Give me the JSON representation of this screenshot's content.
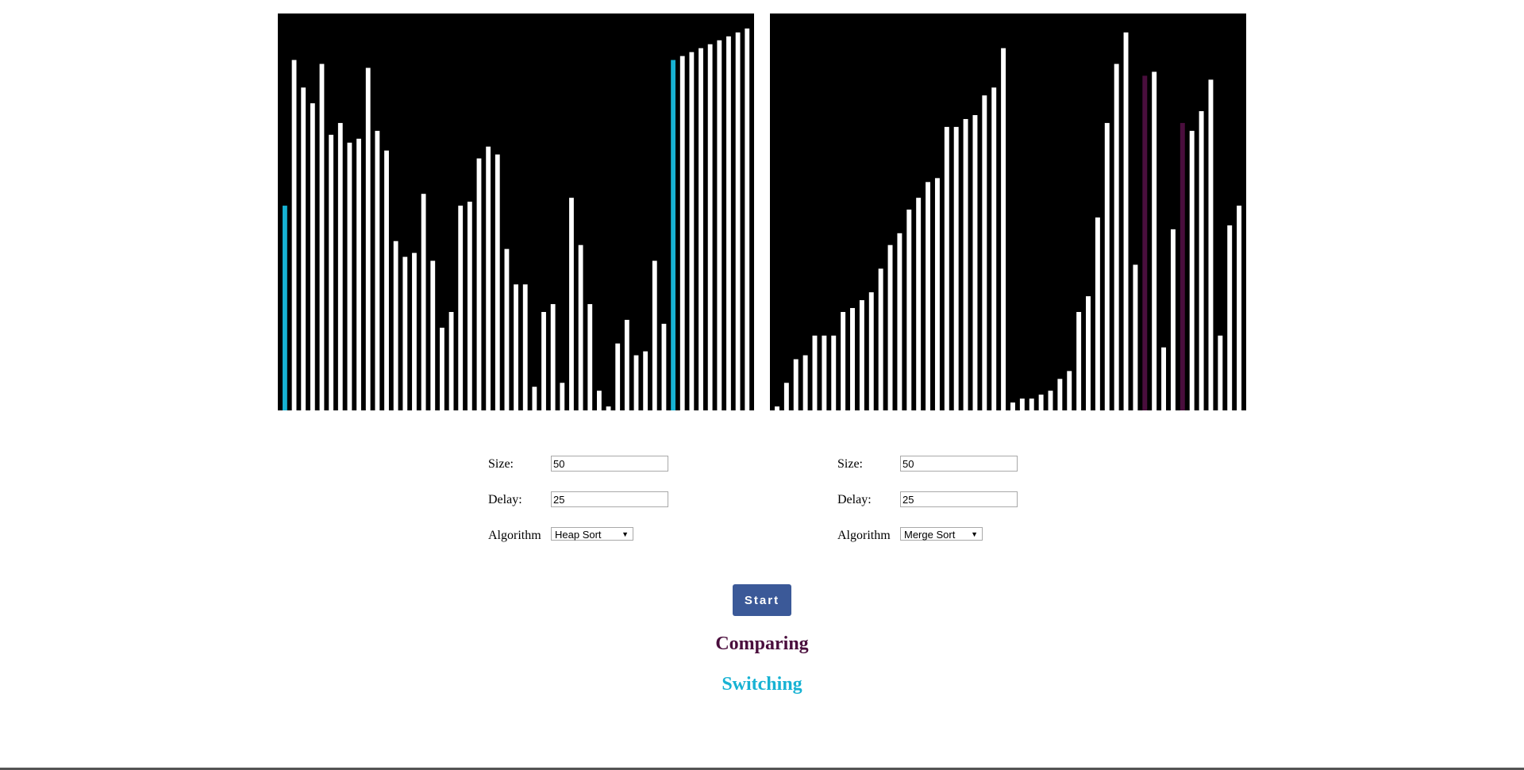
{
  "colors": {
    "background": "#000000",
    "bar": "#ffffff",
    "comparing": "#4a0e3d",
    "switching": "#17b2d3",
    "button": "#3b5998"
  },
  "left_panel": {
    "bar_heights": [
      0.52,
      0.89,
      0.82,
      0.78,
      0.88,
      0.7,
      0.73,
      0.68,
      0.69,
      0.87,
      0.71,
      0.66,
      0.43,
      0.39,
      0.4,
      0.55,
      0.38,
      0.21,
      0.25,
      0.52,
      0.53,
      0.64,
      0.67,
      0.65,
      0.41,
      0.32,
      0.32,
      0.06,
      0.25,
      0.27,
      0.07,
      0.54,
      0.42,
      0.27,
      0.05,
      0.01,
      0.17,
      0.23,
      0.14,
      0.15,
      0.38,
      0.22,
      0.89,
      0.9,
      0.91,
      0.92,
      0.93,
      0.94,
      0.95,
      0.96,
      0.97
    ],
    "switching_indices": [
      0,
      42
    ],
    "comparing_indices": []
  },
  "right_panel": {
    "bar_heights": [
      0.01,
      0.07,
      0.13,
      0.14,
      0.19,
      0.19,
      0.19,
      0.25,
      0.26,
      0.28,
      0.3,
      0.36,
      0.42,
      0.45,
      0.51,
      0.54,
      0.58,
      0.59,
      0.72,
      0.72,
      0.74,
      0.75,
      0.8,
      0.82,
      0.92,
      0.02,
      0.03,
      0.03,
      0.04,
      0.05,
      0.08,
      0.1,
      0.25,
      0.29,
      0.49,
      0.73,
      0.88,
      0.96,
      0.37,
      0.85,
      0.86,
      0.16,
      0.46,
      0.73,
      0.71,
      0.76,
      0.84,
      0.19,
      0.47,
      0.52
    ],
    "switching_indices": [],
    "comparing_indices": [
      39,
      43
    ]
  },
  "controls_left": {
    "size_label": "Size:",
    "size_value": "50",
    "delay_label": "Delay:",
    "delay_value": "25",
    "algorithm_label": "Algorithm",
    "algorithm_selected": "Heap Sort"
  },
  "controls_right": {
    "size_label": "Size:",
    "size_value": "50",
    "delay_label": "Delay:",
    "delay_value": "25",
    "algorithm_label": "Algorithm",
    "algorithm_selected": "Merge Sort"
  },
  "start_button": {
    "label": "Start"
  },
  "legend": {
    "comparing": "Comparing",
    "switching": "Switching"
  }
}
